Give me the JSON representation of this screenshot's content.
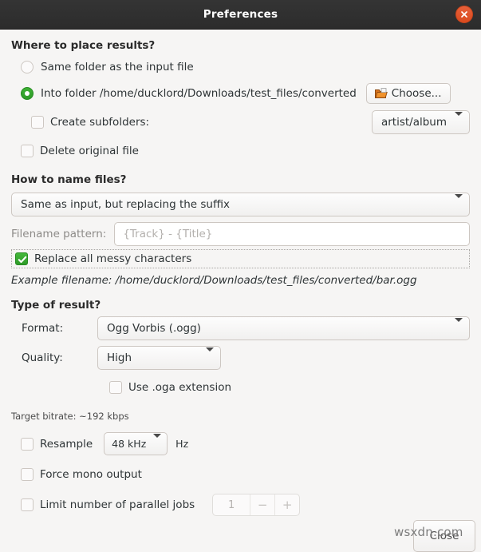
{
  "window": {
    "title": "Preferences",
    "close_icon": "close-icon",
    "accent_green": "#33a02c",
    "close_button_color": "#e0552a",
    "titlebar_color": "#303030",
    "background_color": "#f6f5f4"
  },
  "where": {
    "heading": "Where to place results?",
    "option_same_folder": "Same folder as the input file",
    "option_into_folder": "Into folder /home/ducklord/Downloads/test_files/converted",
    "selected": "into_folder",
    "choose_button": "Choose...",
    "create_subfolders": "Create subfolders:",
    "create_subfolders_checked": false,
    "subfolder_pattern": "artist/album",
    "delete_original": "Delete original file",
    "delete_original_checked": false
  },
  "naming": {
    "heading": "How to name files?",
    "mode": "Same as input, but replacing the suffix",
    "pattern_label": "Filename pattern:",
    "pattern_value": "",
    "pattern_placeholder": "{Track} - {Title}",
    "replace_messy": "Replace all messy characters",
    "replace_messy_checked": true,
    "example_label": "Example filename:",
    "example_value": "/home/ducklord/Downloads/test_files/converted/bar.ogg"
  },
  "result": {
    "heading": "Type of result?",
    "format_label": "Format:",
    "format_value": "Ogg Vorbis (.ogg)",
    "quality_label": "Quality:",
    "quality_value": "High",
    "use_oga": "Use .oga extension",
    "use_oga_checked": false,
    "bitrate_hint": "Target bitrate: ~192 kbps",
    "resample_label": "Resample",
    "resample_checked": false,
    "resample_value": "48 kHz",
    "resample_unit": "Hz",
    "force_mono": "Force mono output",
    "force_mono_checked": false,
    "limit_jobs": "Limit number of parallel jobs",
    "limit_jobs_checked": false,
    "jobs_value": "1",
    "jobs_minus": "−",
    "jobs_plus": "+"
  },
  "footer": {
    "close_label": "Close",
    "watermark": "wsxdn.com"
  }
}
